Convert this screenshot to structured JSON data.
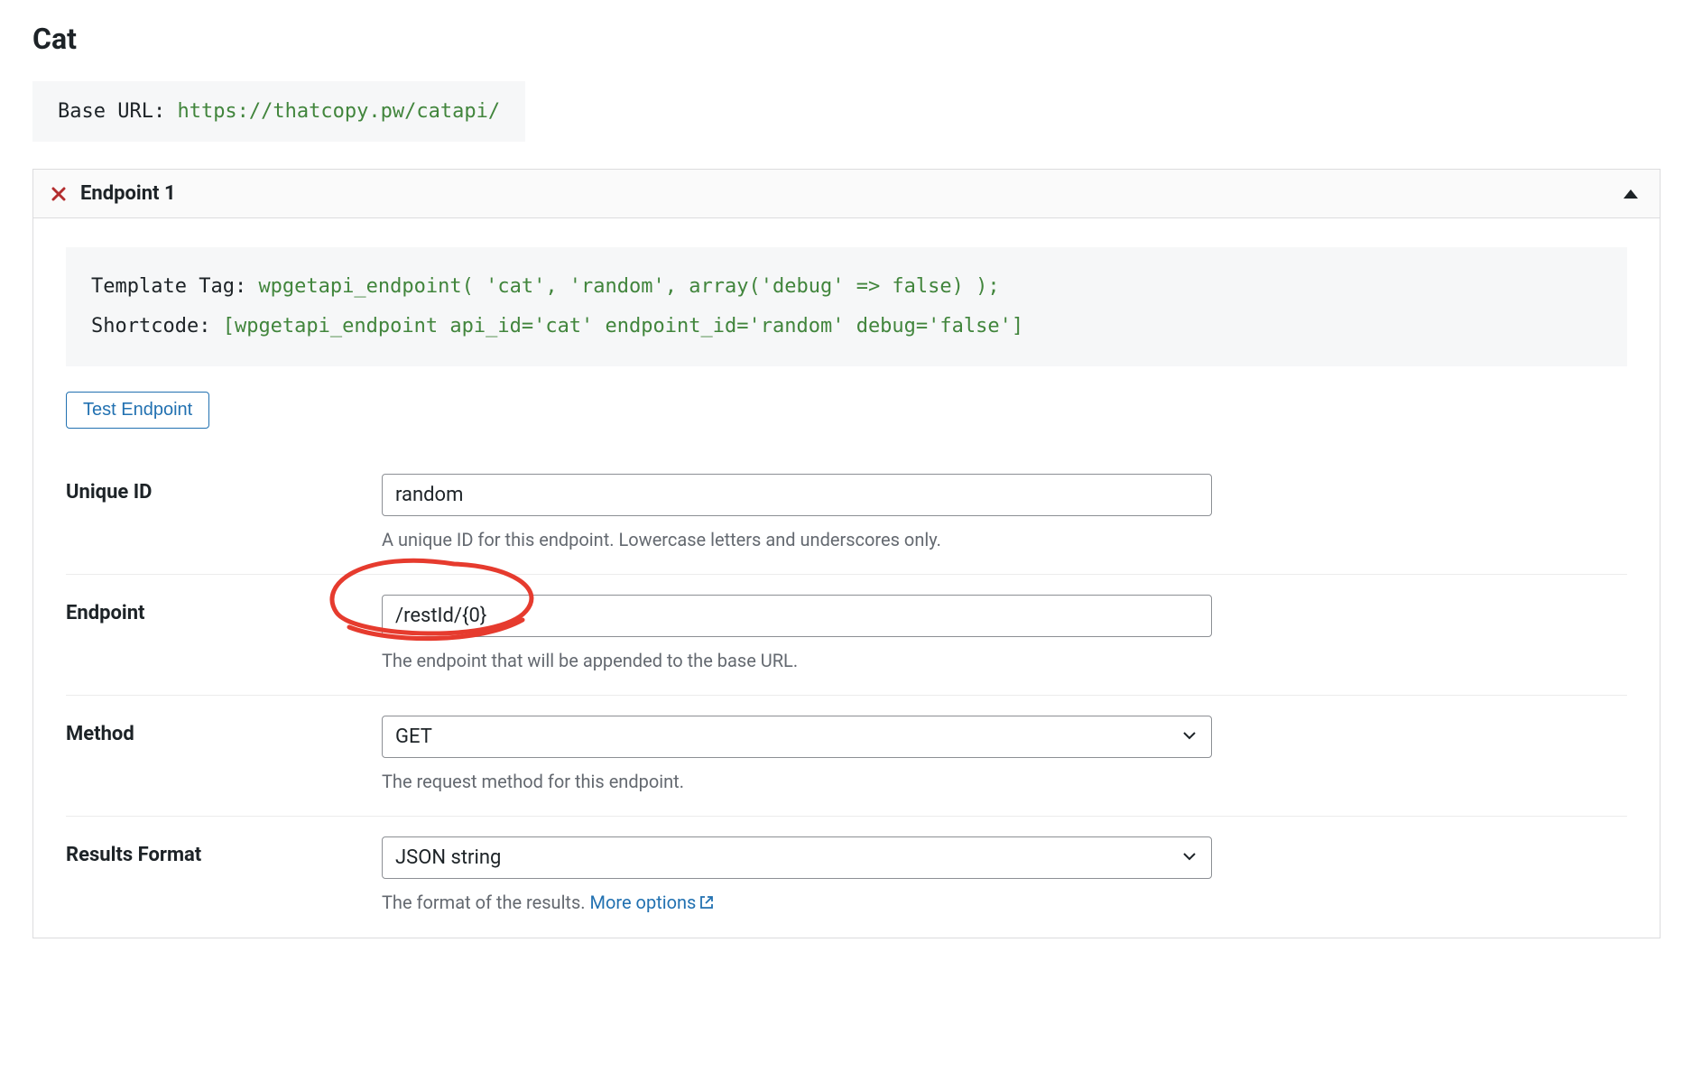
{
  "page": {
    "title": "Cat"
  },
  "base_url_box": {
    "label": "Base URL: ",
    "value": "https://thatcopy.pw/catapi/"
  },
  "endpoint_panel": {
    "title": "Endpoint 1",
    "snippets": {
      "template_tag_label": "Template Tag: ",
      "template_tag_value": "wpgetapi_endpoint( 'cat', 'random', array('debug' => false) );",
      "shortcode_label": "Shortcode: ",
      "shortcode_value": "[wpgetapi_endpoint api_id='cat' endpoint_id='random' debug='false']"
    },
    "test_button_label": "Test Endpoint",
    "fields": {
      "unique_id": {
        "label": "Unique ID",
        "value": "random",
        "help": "A unique ID for this endpoint. Lowercase letters and underscores only."
      },
      "endpoint": {
        "label": "Endpoint",
        "value": "/restId/{0}",
        "help": "The endpoint that will be appended to the base URL."
      },
      "method": {
        "label": "Method",
        "value": "GET",
        "help": "The request method for this endpoint."
      },
      "results_format": {
        "label": "Results Format",
        "value": "JSON string",
        "help": "The format of the results. ",
        "more_link": "More options"
      }
    }
  }
}
